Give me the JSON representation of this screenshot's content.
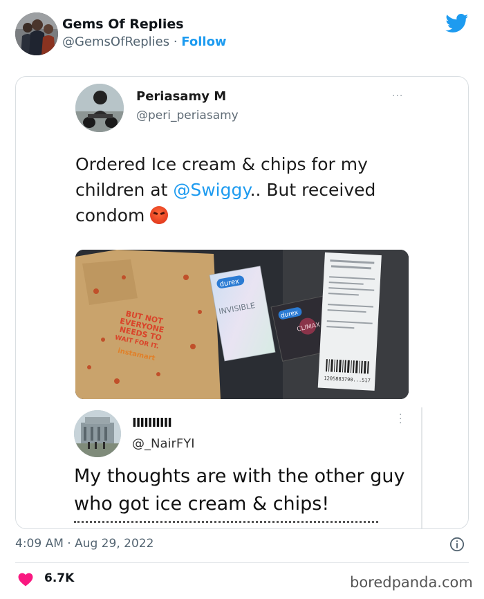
{
  "author": {
    "name": "Gems Of Replies",
    "handle": "@GemsOfReplies",
    "separator": "·",
    "follow_label": "Follow"
  },
  "embedded_tweet": {
    "name": "Periasamy M",
    "handle": "@peri_periasamy",
    "more_label": "···",
    "text_before": "Ordered Ice cream & chips for my children at ",
    "mention": "@Swiggy",
    "text_after": ".. But received condom ",
    "emoji": "angry-face-emoji",
    "photo": {
      "bag_text": [
        "BUT NOT",
        "EVERYONE",
        "NEEDS TO",
        "WAIT FOR IT."
      ],
      "bag_brand": "instamart",
      "box1_brand": "durex",
      "box1_label": "INVISIBLE",
      "box2_brand": "durex",
      "box2_label": "CLIMAX",
      "receipt_barcode": "1205883790...517"
    }
  },
  "reply": {
    "name": "IIIIIIIIII",
    "handle": "@_NairFYI",
    "text": "My thoughts are with the other guy who got ice cream & chips!"
  },
  "meta": {
    "timestamp": "4:09 AM · Aug 29, 2022",
    "likes": "6.7K",
    "watermark": "boredpanda.com"
  },
  "colors": {
    "twitter_blue": "#1d9bf0",
    "like_red": "#f91880",
    "text_dark": "#0f1419",
    "text_muted": "#536471"
  }
}
